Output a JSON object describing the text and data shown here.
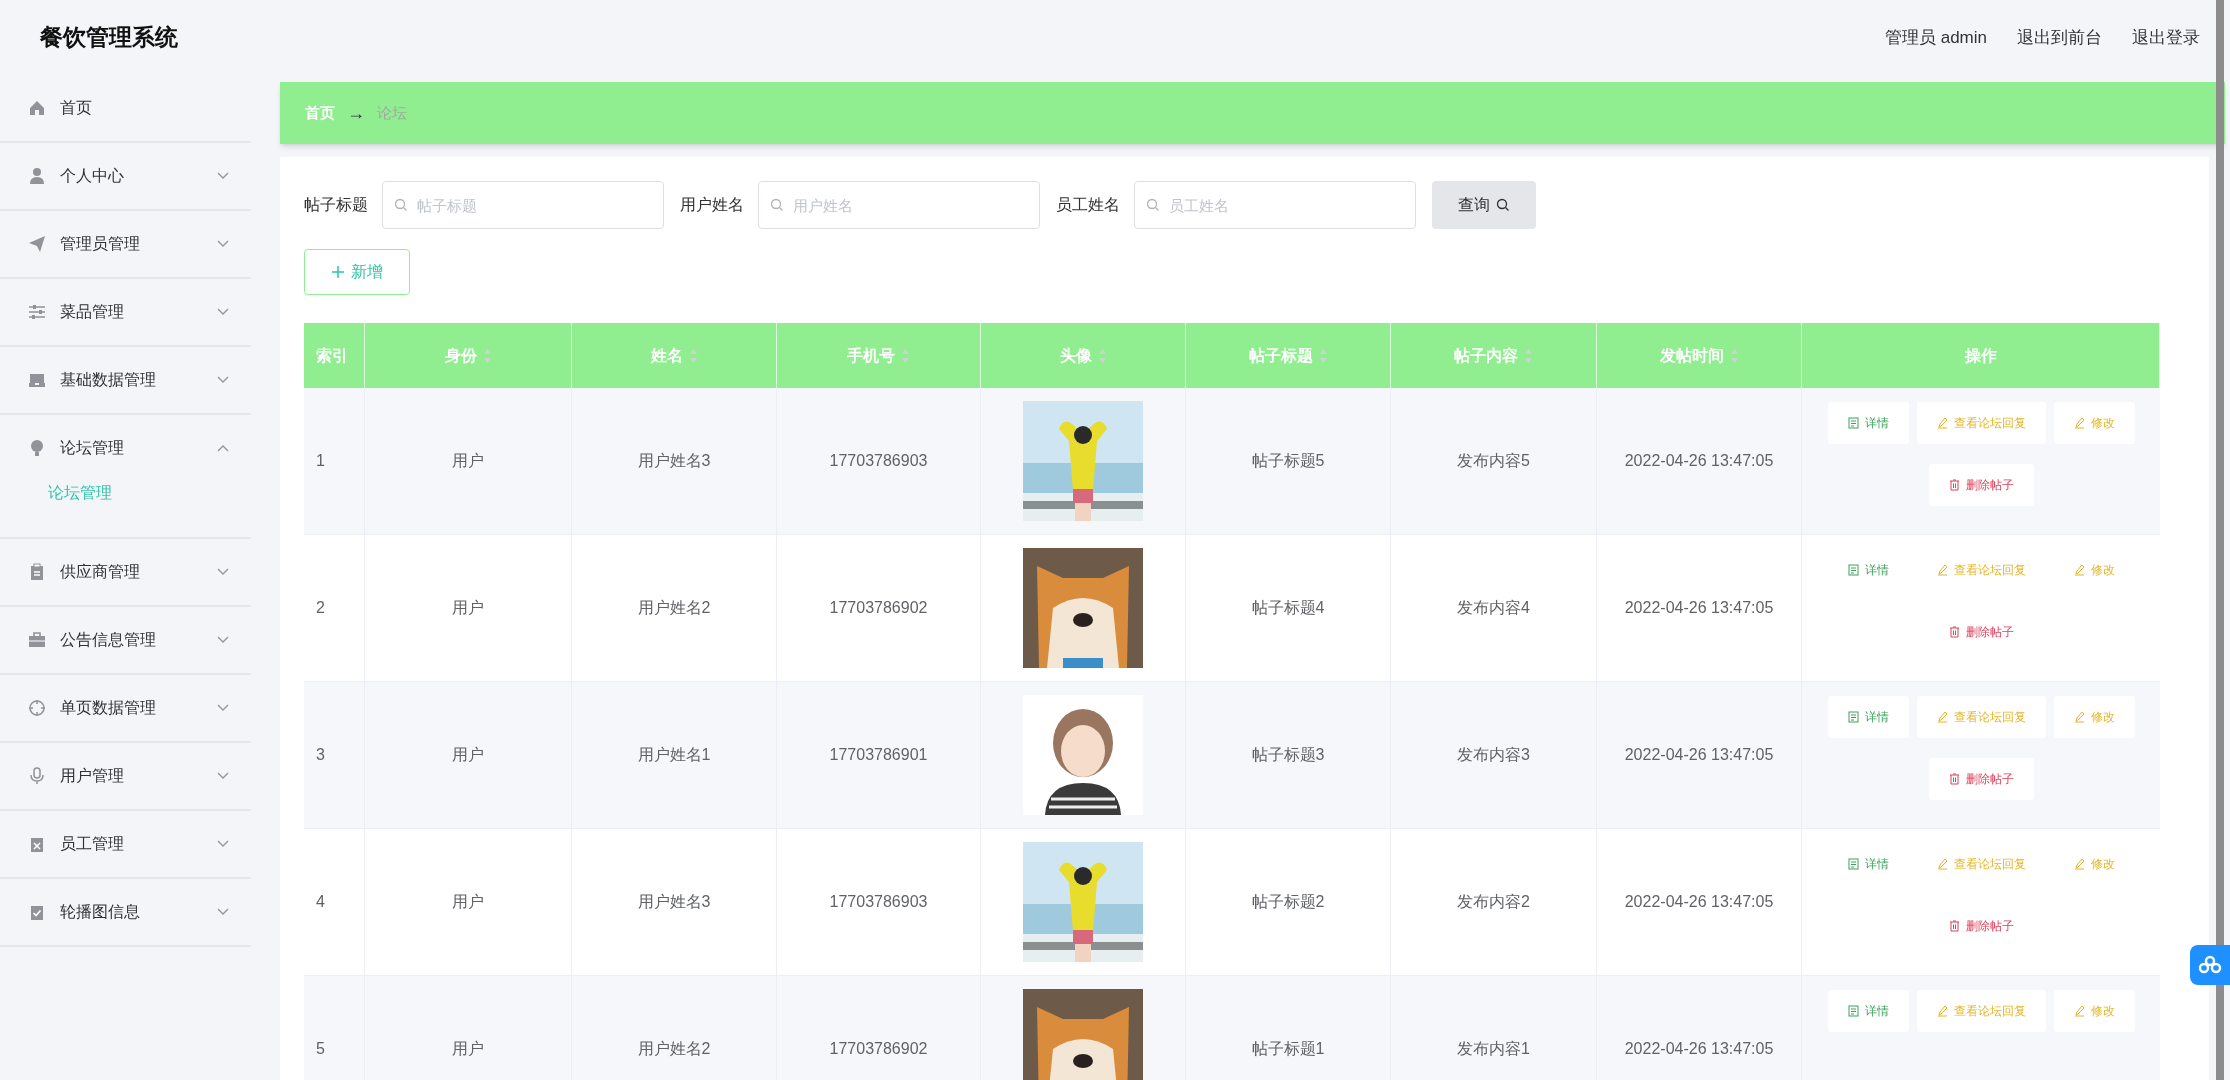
{
  "header": {
    "title": "餐饮管理系统",
    "links": [
      "管理员 admin",
      "退出到前台",
      "退出登录"
    ]
  },
  "sidebar": {
    "items": [
      {
        "label": "首页"
      },
      {
        "label": "个人中心",
        "expanded": false
      },
      {
        "label": "管理员管理",
        "expanded": false
      },
      {
        "label": "菜品管理",
        "expanded": false
      },
      {
        "label": "基础数据管理",
        "expanded": false
      },
      {
        "label": "论坛管理",
        "expanded": true,
        "children": [
          {
            "label": "论坛管理",
            "selected": true
          }
        ]
      },
      {
        "label": "供应商管理",
        "expanded": false
      },
      {
        "label": "公告信息管理",
        "expanded": false
      },
      {
        "label": "单页数据管理",
        "expanded": false
      },
      {
        "label": "用户管理",
        "expanded": false
      },
      {
        "label": "员工管理",
        "expanded": false
      },
      {
        "label": "轮播图信息",
        "expanded": false
      }
    ]
  },
  "breadcrumb": [
    "首页",
    "→",
    "论坛"
  ],
  "search": {
    "fields": [
      {
        "label": "帖子标题",
        "placeholder": "帖子标题"
      },
      {
        "label": "用户姓名",
        "placeholder": "用户姓名"
      },
      {
        "label": "员工姓名",
        "placeholder": "员工姓名"
      }
    ],
    "query_button": "查询"
  },
  "add_button": "新增",
  "table": {
    "columns": [
      {
        "label": "索引",
        "sortable": false
      },
      {
        "label": "身份",
        "sortable": true
      },
      {
        "label": "姓名",
        "sortable": true
      },
      {
        "label": "手机号",
        "sortable": true
      },
      {
        "label": "头像",
        "sortable": true
      },
      {
        "label": "帖子标题",
        "sortable": true
      },
      {
        "label": "帖子内容",
        "sortable": true
      },
      {
        "label": "发帖时间",
        "sortable": true
      },
      {
        "label": "操作",
        "sortable": false
      }
    ],
    "rows": [
      {
        "index": "1",
        "role": "用户",
        "name": "用户姓名3",
        "phone": "17703786903",
        "avatar": {
          "kind": "picture"
        },
        "title": "帖子标题5",
        "content": "发布内容5",
        "time": "2022-04-26 13:47:05",
        "actions": [
          {
            "kind": "detail",
            "label": "详情"
          },
          {
            "kind": "replies",
            "label": "查看论坛回复"
          },
          {
            "kind": "edit",
            "label": "修改"
          },
          {
            "kind": "delete",
            "label": "删除帖子"
          }
        ]
      },
      {
        "index": "2",
        "role": "用户",
        "name": "用户姓名2",
        "phone": "17703786902",
        "avatar": {
          "kind": "picture"
        },
        "title": "帖子标题4",
        "content": "发布内容4",
        "time": "2022-04-26 13:47:05",
        "actions": [
          {
            "kind": "detail",
            "label": "详情"
          },
          {
            "kind": "replies",
            "label": "查看论坛回复"
          },
          {
            "kind": "edit",
            "label": "修改"
          },
          {
            "kind": "delete",
            "label": "删除帖子"
          }
        ]
      },
      {
        "index": "3",
        "role": "用户",
        "name": "用户姓名1",
        "phone": "17703786901",
        "avatar": {
          "kind": "picture"
        },
        "title": "帖子标题3",
        "content": "发布内容3",
        "time": "2022-04-26 13:47:05",
        "actions": [
          {
            "kind": "detail",
            "label": "详情"
          },
          {
            "kind": "replies",
            "label": "查看论坛回复"
          },
          {
            "kind": "edit",
            "label": "修改"
          },
          {
            "kind": "delete",
            "label": "删除帖子"
          }
        ]
      },
      {
        "index": "4",
        "role": "用户",
        "name": "用户姓名3",
        "phone": "17703786903",
        "avatar": {
          "kind": "picture"
        },
        "title": "帖子标题2",
        "content": "发布内容2",
        "time": "2022-04-26 13:47:05",
        "actions": [
          {
            "kind": "detail",
            "label": "详情"
          },
          {
            "kind": "replies",
            "label": "查看论坛回复"
          },
          {
            "kind": "edit",
            "label": "修改"
          },
          {
            "kind": "delete",
            "label": "删除帖子"
          }
        ]
      },
      {
        "index": "5",
        "role": "用户",
        "name": "用户姓名2",
        "phone": "17703786902",
        "avatar": {
          "kind": "picture"
        },
        "title": "帖子标题1",
        "content": "发布内容1",
        "time": "2022-04-26 13:47:05",
        "actions": [
          {
            "kind": "detail",
            "label": "详情"
          },
          {
            "kind": "replies",
            "label": "查看论坛回复"
          },
          {
            "kind": "edit",
            "label": "修改"
          }
        ]
      }
    ]
  }
}
